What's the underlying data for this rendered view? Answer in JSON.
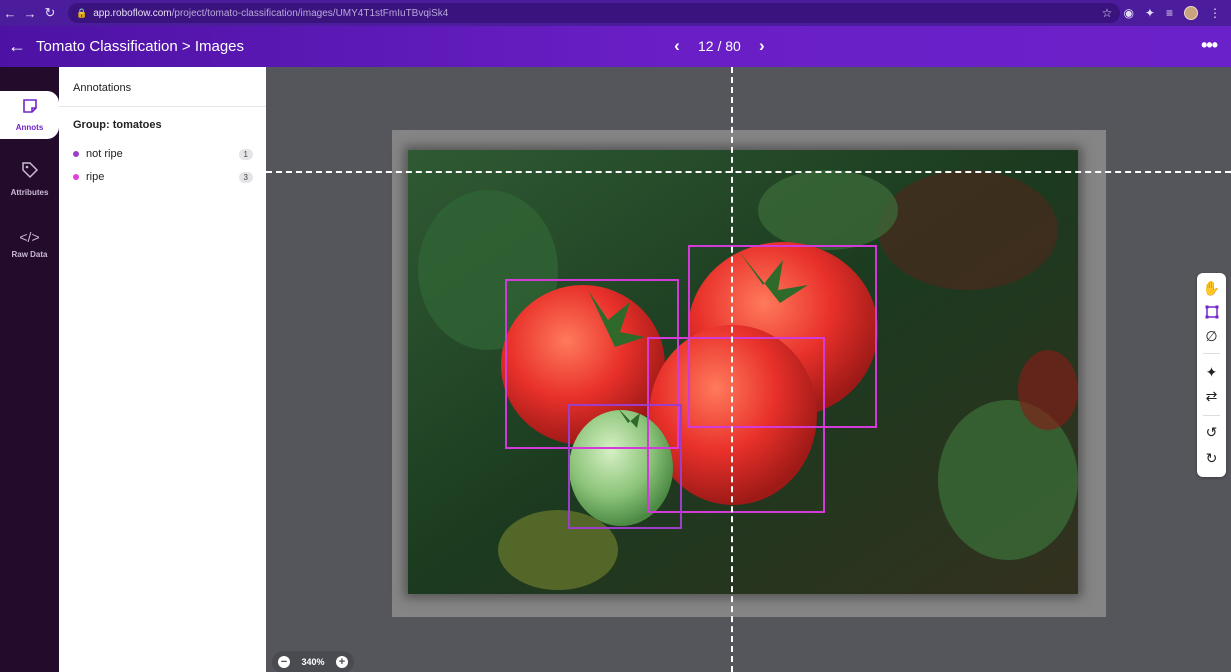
{
  "browser": {
    "url_domain": "app.roboflow.com",
    "url_path": "/project/tomato-classification/images/UMY4T1stFmIuTBvqiSk4",
    "back_icon": "arrow-left-icon",
    "forward_icon": "arrow-right-icon",
    "reload_icon": "reload-icon",
    "lock_icon": "lock-icon"
  },
  "header": {
    "title": "Tomato Classification > Images",
    "back_icon": "arrow-left-icon",
    "prev_icon": "chevron-left-icon",
    "next_icon": "chevron-right-icon",
    "page_counter": "12 / 80",
    "menu_icon": "more-icon"
  },
  "rail": {
    "items": [
      {
        "label": "Annots",
        "icon": "annotation-note-icon",
        "active": true
      },
      {
        "label": "Attributes",
        "icon": "tag-icon",
        "active": false
      },
      {
        "label": "Raw Data",
        "icon": "code-icon",
        "active": false
      }
    ]
  },
  "panel": {
    "title": "Annotations",
    "group_title": "Group: tomatoes",
    "classes": [
      {
        "name": "not ripe",
        "count": "1",
        "color": "#9d3ec9"
      },
      {
        "name": "ripe",
        "count": "3",
        "color": "#e040d8"
      }
    ]
  },
  "annotations": [
    {
      "label": "ripe",
      "color": "#d33bd8"
    },
    {
      "label": "ripe",
      "color": "#d33bd8"
    },
    {
      "label": "ripe",
      "color": "#d33bd8"
    },
    {
      "label": "not ripe",
      "color": "#9d3ec9"
    }
  ],
  "tools": [
    {
      "name": "pan-hand-icon",
      "active": false
    },
    {
      "name": "bounding-box-icon",
      "active": true
    },
    {
      "name": "polygon-icon",
      "active": false
    },
    {
      "name": "smart-magic-icon",
      "active": false
    },
    {
      "name": "repeat-icon",
      "active": false
    },
    {
      "name": "undo-icon",
      "active": false
    },
    {
      "name": "redo-icon",
      "active": false
    }
  ],
  "zoom": {
    "level": "340%",
    "zoom_out_icon": "minus-circle-icon",
    "zoom_in_icon": "plus-circle-icon"
  },
  "colors": {
    "brand_purple": "#6a1fc6",
    "rail_dark": "#230b2c",
    "canvas_gray": "#55565c"
  }
}
